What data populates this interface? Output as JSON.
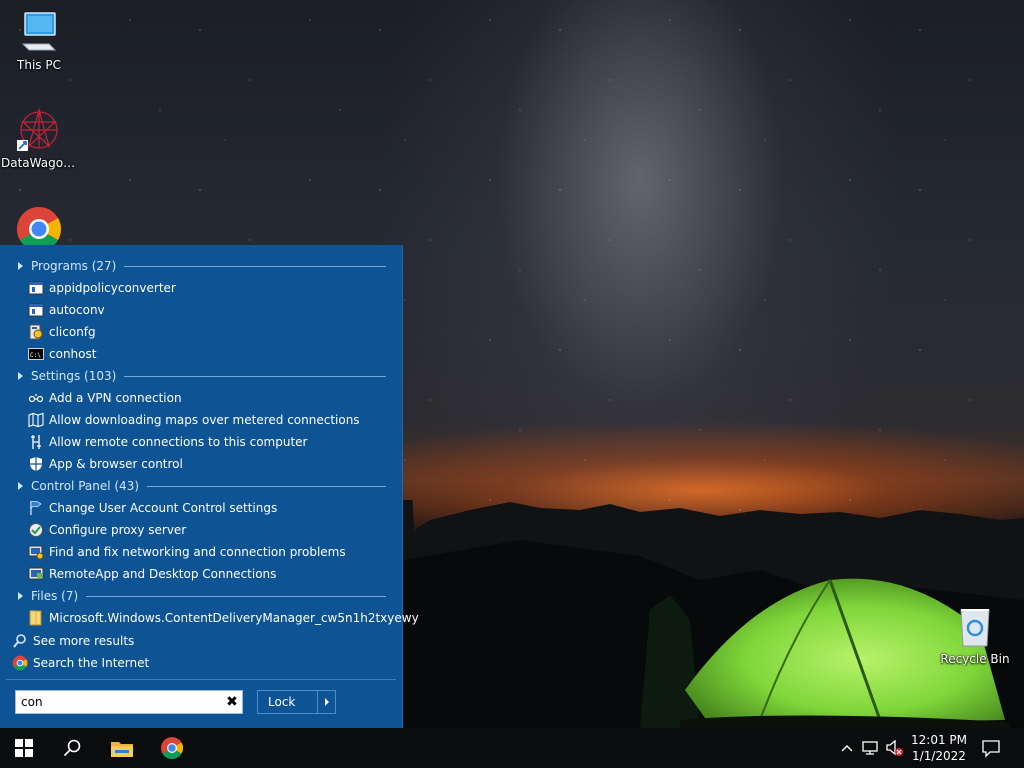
{
  "desktop": {
    "icons": [
      {
        "label": "This PC",
        "icon": "monitor-icon"
      },
      {
        "label": "DataWagon...",
        "icon": "datawagon-logo-icon"
      },
      {
        "label": "",
        "icon": "chrome-icon"
      },
      {
        "label": "Recycle Bin",
        "icon": "recycle-bin-icon"
      }
    ]
  },
  "start_panel": {
    "sections": [
      {
        "title": "Programs (27)",
        "items": [
          {
            "label": "appidpolicyconverter",
            "icon": "app-window-icon"
          },
          {
            "label": "autoconv",
            "icon": "app-window-icon"
          },
          {
            "label": "cliconfg",
            "icon": "config-icon"
          },
          {
            "label": "conhost",
            "icon": "console-icon"
          }
        ]
      },
      {
        "title": "Settings (103)",
        "items": [
          {
            "label": "Add a VPN connection",
            "icon": "vpn-icon"
          },
          {
            "label": "Allow downloading maps over metered connections",
            "icon": "map-icon"
          },
          {
            "label": "Allow remote connections to this computer",
            "icon": "remote-icon"
          },
          {
            "label": "App & browser control",
            "icon": "shield-icon"
          }
        ]
      },
      {
        "title": "Control Panel (43)",
        "items": [
          {
            "label": "Change User Account Control settings",
            "icon": "uac-flag-icon"
          },
          {
            "label": "Configure proxy server",
            "icon": "proxy-icon"
          },
          {
            "label": "Find and fix networking and connection problems",
            "icon": "network-troubleshoot-icon"
          },
          {
            "label": "RemoteApp and Desktop Connections",
            "icon": "remoteapp-icon"
          }
        ]
      },
      {
        "title": "Files (7)",
        "items": [
          {
            "label": "Microsoft.Windows.ContentDeliveryManager_cw5n1h2txyewy",
            "icon": "folder-icon"
          }
        ]
      }
    ],
    "see_more": "See more results",
    "search_internet": "Search the Internet",
    "search": {
      "value": "con",
      "clear_icon": "close-icon"
    },
    "lock_label": "Lock"
  },
  "taskbar": {
    "items": [
      "windows-logo-icon",
      "search-icon",
      "file-explorer-icon",
      "chrome-icon"
    ],
    "tray": [
      "chevron-up-icon",
      "network-icon",
      "volume-muted-icon"
    ],
    "time": "12:01 PM",
    "date": "1/1/2022",
    "notification_icon": "action-center-icon"
  },
  "colors": {
    "panel_bg": "#0e5494",
    "section_header": "#cfe6ff",
    "taskbar_bg": "#0b0c0e",
    "tent_green": "#7fd63a"
  }
}
